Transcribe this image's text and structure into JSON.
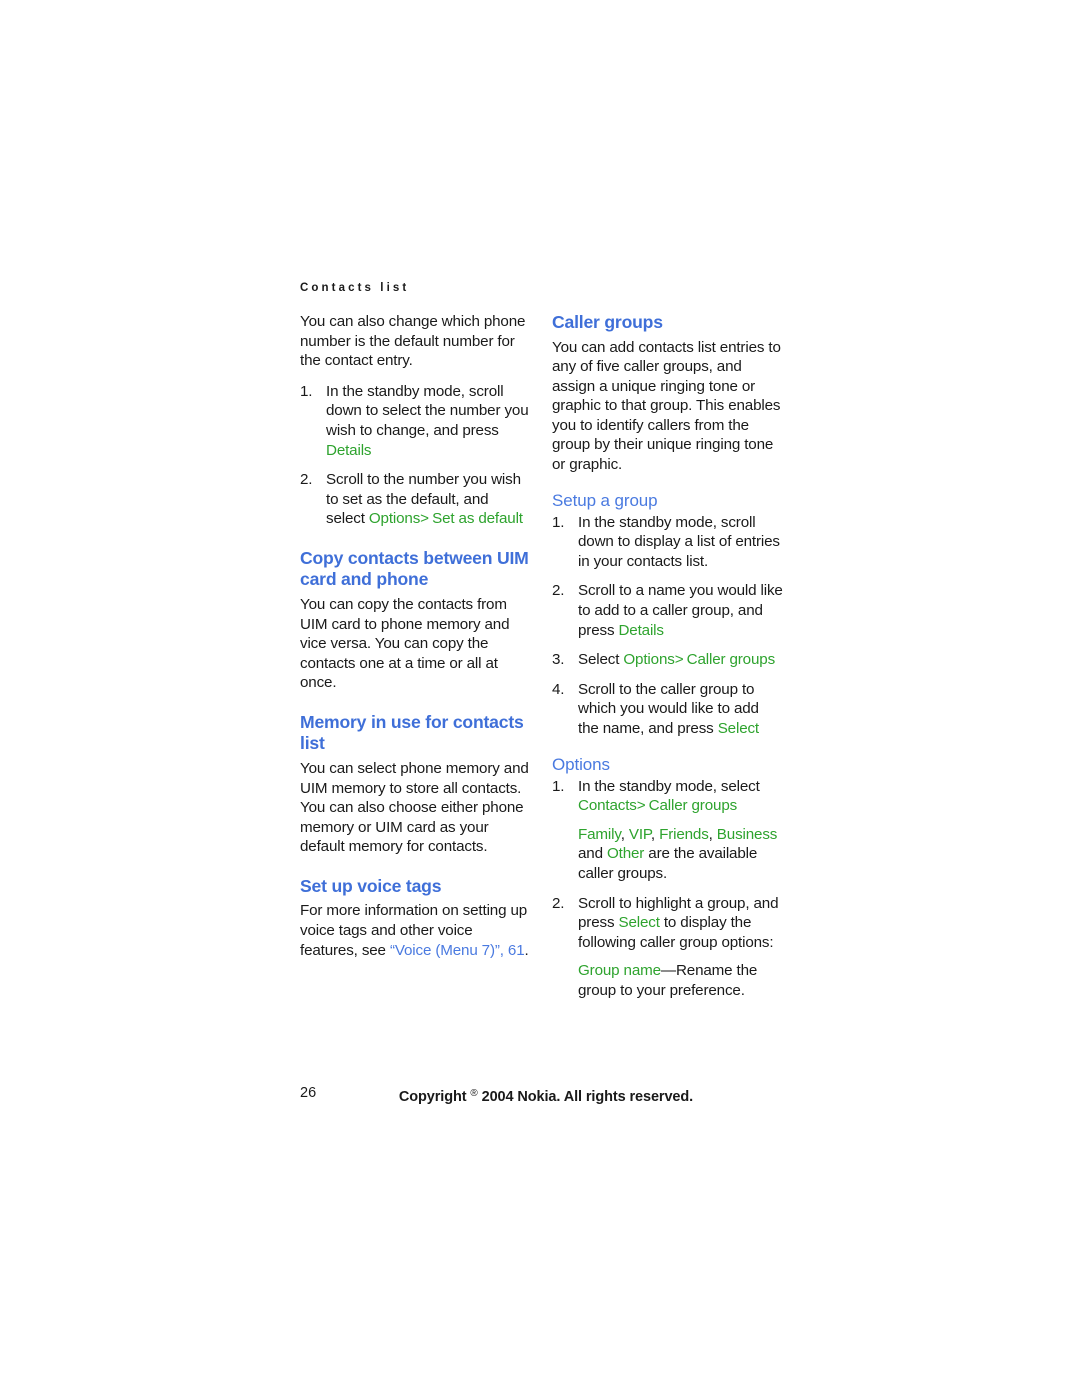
{
  "page": {
    "running_header": "Contacts list",
    "folio": "26",
    "copyright_prefix": "Copyright ",
    "copyright_symbol": "®",
    "copyright_suffix": " 2004 Nokia. All rights reserved."
  },
  "colors": {
    "heading_blue": "#3f6fd8",
    "subheading_blue": "#4a7ae0",
    "ui_green": "#2ea32e",
    "body_text": "#1a1a1a",
    "page_background": "#ffffff"
  },
  "left_column": {
    "intro": "You can also change which phone number is the default number for the contact entry.",
    "default_number_steps": [
      {
        "num": "1.",
        "text_before": "In the standby mode, scroll down to select the number you wish to change, and press ",
        "ui_1": "Details",
        "text_middle": "",
        "ui_2": "",
        "text_after": ""
      },
      {
        "num": "2.",
        "text_before": "Scroll to the number you wish to set as the default, and select ",
        "ui_1": "Options",
        "separator": ">",
        "ui_2": " Set as default",
        "text_after": ""
      }
    ],
    "copy_uim": {
      "heading": "Copy contacts between UIM card and phone",
      "body": "You can copy the contacts from UIM card to phone memory and vice versa. You can copy the contacts one at a time or all at once."
    },
    "memory_in_use": {
      "heading": "Memory in use for contacts list",
      "body": "You can select phone memory and UIM memory to store all contacts. You can also choose either phone memory or UIM card as your default memory for contacts."
    },
    "voice_tags": {
      "heading": "Set up voice tags",
      "body_before": "For more information on setting up voice tags and other voice features, see ",
      "xref": "“Voice (Menu 7)”, 61",
      "body_after": "."
    }
  },
  "right_column": {
    "caller_groups": {
      "heading": "Caller groups",
      "body": "You can add contacts list entries to any of five caller groups, and assign a unique ringing tone or graphic to that group. This enables you to identify callers from the group by their unique ringing tone or graphic."
    },
    "setup_group": {
      "subheading": "Setup a group",
      "steps": [
        {
          "num": "1.",
          "text": "In the standby mode, scroll down to display a list of entries in your contacts list."
        },
        {
          "num": "2.",
          "text_before": "Scroll to a name you would like to add to a caller group, and press ",
          "ui_1": "Details"
        },
        {
          "num": "3.",
          "text_before": "Select ",
          "ui_1": "Options",
          "separator": ">",
          "ui_2": " Caller groups"
        },
        {
          "num": "4.",
          "text_before": "Scroll to the caller group to which you would like to add the name, and press ",
          "ui_1": "Select"
        }
      ]
    },
    "options": {
      "subheading": "Options",
      "steps": [
        {
          "num": "1.",
          "text_before": "In the standby mode, select ",
          "ui_1": "Contacts",
          "separator": ">",
          "ui_2": " Caller groups",
          "group_family": "Family",
          "group_vip": "VIP",
          "group_friends": "Friends",
          "group_business": "Business",
          "group_other": "Other",
          "sub_text_and": " and ",
          "sub_text_after": " are the available caller groups."
        },
        {
          "num": "2.",
          "text_before": "Scroll to highlight a group, and press ",
          "ui_1": "Select",
          "text_after": " to display the following caller group options:",
          "option_name": "Group name",
          "option_desc": "—Rename the group to your preference."
        }
      ]
    }
  }
}
